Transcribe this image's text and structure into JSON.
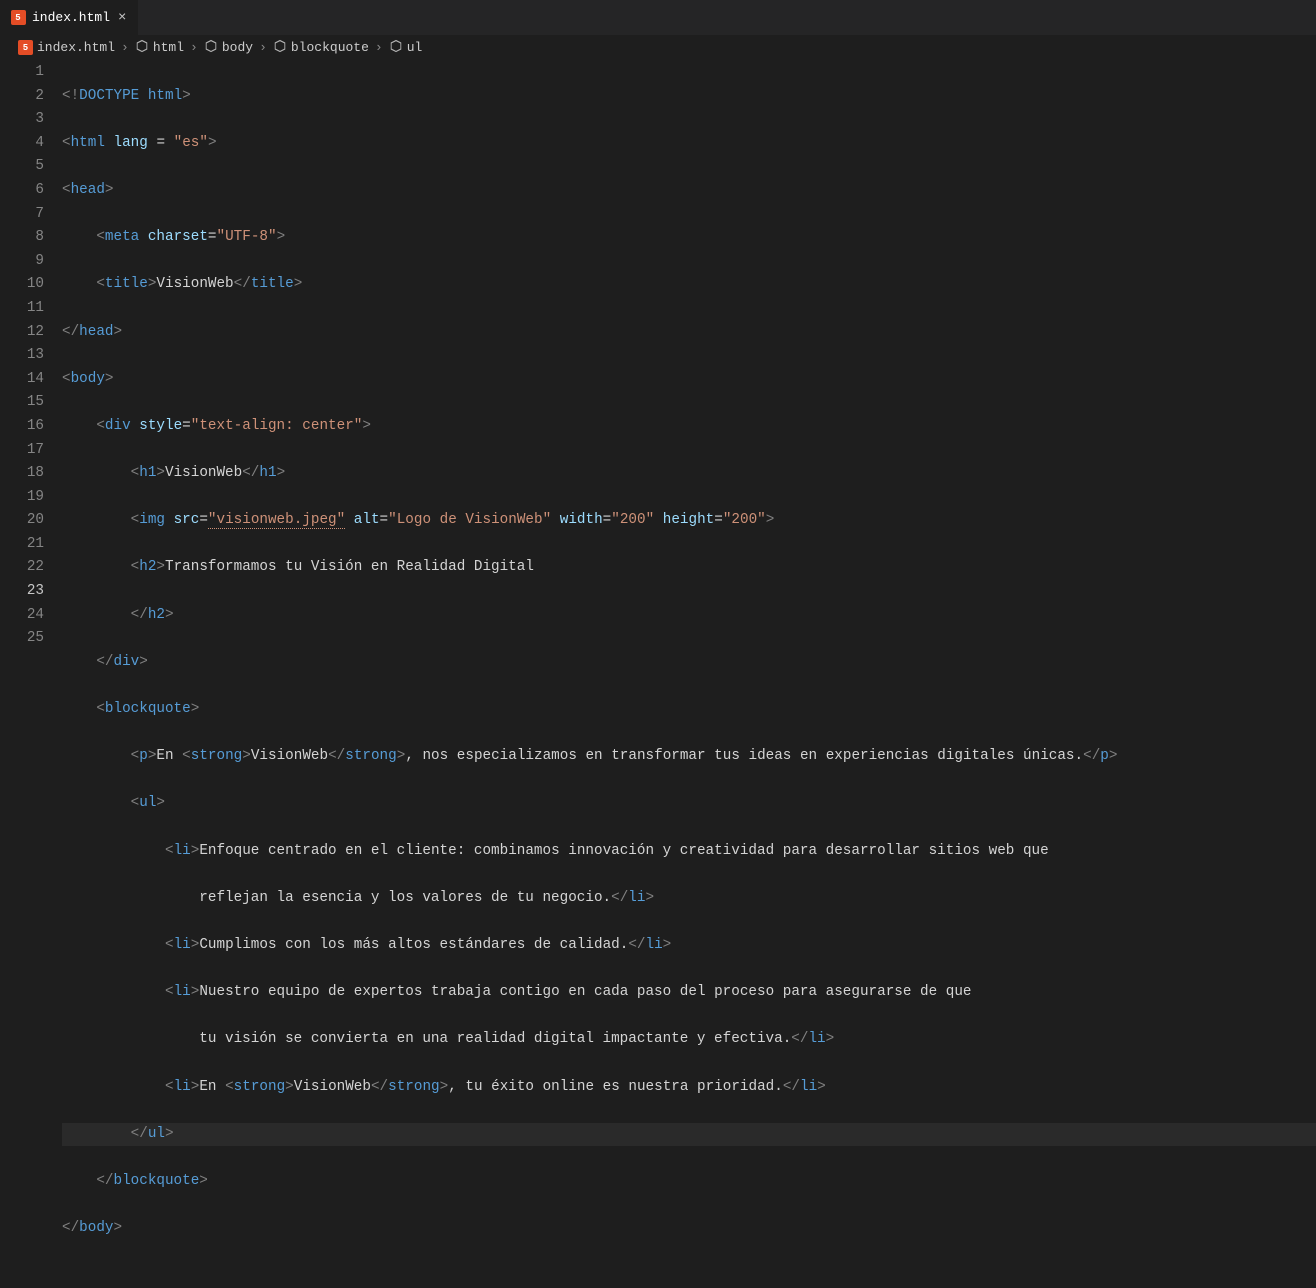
{
  "tab": {
    "filename": "index.html",
    "close": "×"
  },
  "breadcrumbs": {
    "file": "index.html",
    "items": [
      "html",
      "body",
      "blockquote",
      "ul"
    ],
    "sep": "›"
  },
  "lines": {
    "count": 25
  },
  "code": {
    "l1_doctype": "DOCTYPE",
    "l1_html": "html",
    "l2_tag": "html",
    "l2_attr": "lang",
    "l2_val": "\"es\"",
    "l3_tag": "head",
    "l4_tag": "meta",
    "l4_attr": "charset",
    "l4_val": "\"UTF-8\"",
    "l5_tag": "title",
    "l5_text": "VisionWeb",
    "l6_tag": "head",
    "l7_tag": "body",
    "l8_tag": "div",
    "l8_attr": "style",
    "l8_val": "\"text-align: center\"",
    "l9_tag": "h1",
    "l9_text": "VisionWeb",
    "l10_tag": "img",
    "l10_a1": "src",
    "l10_v1": "\"visionweb.jpeg\"",
    "l10_a2": "alt",
    "l10_v2": "\"Logo de VisionWeb\"",
    "l10_a3": "width",
    "l10_v3": "\"200\"",
    "l10_a4": "height",
    "l10_v4": "\"200\"",
    "l11_tag": "h2",
    "l11_text": "Transformamos tu Visión en Realidad Digital",
    "l12_tag": "h2",
    "l13_tag": "div",
    "l14_tag": "blockquote",
    "l15_tag": "p",
    "l15_t1": "En ",
    "l15_strong": "strong",
    "l15_st": "VisionWeb",
    "l15_t2": ", nos especializamos en transformar tus ideas en experiencias digitales únicas.",
    "l16_tag": "ul",
    "l17_tag": "li",
    "l17_text": "Enfoque centrado en el cliente: combinamos innovación y creatividad para desarrollar sitios web que ",
    "l18_text": "reflejan la esencia y los valores de tu negocio.",
    "l19_tag": "li",
    "l19_text": "Cumplimos con los más altos estándares de calidad.",
    "l20_tag": "li",
    "l20_text": "Nuestro equipo de expertos trabaja contigo en cada paso del proceso para asegurarse de que ",
    "l21_text": "tu visión se convierta en una realidad digital impactante y efectiva.",
    "l22_tag": "li",
    "l22_t1": "En ",
    "l22_strong": "strong",
    "l22_st": "VisionWeb",
    "l22_t2": ", tu éxito online es nuestra prioridad.",
    "l23_tag": "ul",
    "l24_tag": "blockquote",
    "l25_tag": "body"
  }
}
